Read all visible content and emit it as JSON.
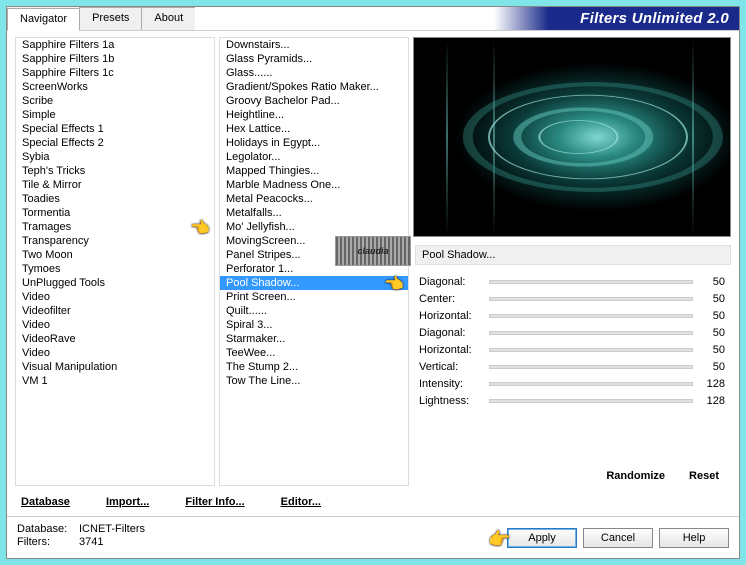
{
  "app_title": "Filters Unlimited 2.0",
  "tabs": [
    "Navigator",
    "Presets",
    "About"
  ],
  "active_tab": 0,
  "categories": [
    "Sapphire Filters 1a",
    "Sapphire Filters 1b",
    "Sapphire Filters 1c",
    "ScreenWorks",
    "Scribe",
    "Simple",
    "Special Effects 1",
    "Special Effects 2",
    "Sybia",
    "Teph's Tricks",
    "Tile & Mirror",
    "Toadies",
    "Tormentia",
    "Tramages",
    "Transparency",
    "Two Moon",
    "Tymoes",
    "UnPlugged Tools",
    "Video",
    "Videofilter",
    "Video",
    "VideoRave",
    "Video",
    "Visual Manipulation",
    "VM 1"
  ],
  "category_selected_index": 13,
  "filters": [
    "Downstairs...",
    "Glass Pyramids...",
    "Glass......",
    "Gradient/Spokes Ratio Maker...",
    "Groovy Bachelor Pad...",
    "Heightline...",
    "Hex Lattice...",
    "Holidays in Egypt...",
    "Legolator...",
    "Mapped Thingies...",
    "Marble Madness One...",
    "Metal Peacocks...",
    "Metalfalls...",
    "Mo' Jellyfish...",
    "MovingScreen...",
    "Panel Stripes...",
    "Perforator 1...",
    "Pool Shadow...",
    "Print Screen...",
    "Quilt......",
    "Spiral 3...",
    "Starmaker...",
    "TeeWee...",
    "The Stump 2...",
    "Tow The Line..."
  ],
  "filter_selected_index": 17,
  "current_filter_label": "Pool Shadow...",
  "watermark_text": "claudia",
  "params": [
    {
      "label": "Diagonal:",
      "value": 50
    },
    {
      "label": "Center:",
      "value": 50
    },
    {
      "label": "Horizontal:",
      "value": 50
    },
    {
      "label": "Diagonal:",
      "value": 50
    },
    {
      "label": "Horizontal:",
      "value": 50
    },
    {
      "label": "Vertical:",
      "value": 50
    },
    {
      "label": "Intensity:",
      "value": 128
    },
    {
      "label": "Lightness:",
      "value": 128
    }
  ],
  "bottom_links": [
    "Database",
    "Import...",
    "Filter Info...",
    "Editor..."
  ],
  "randomize_label": "Randomize",
  "reset_label": "Reset",
  "db_label": "Database:",
  "db_value": "ICNET-Filters",
  "filters_count_label": "Filters:",
  "filters_count_value": "3741",
  "apply_label": "Apply",
  "cancel_label": "Cancel",
  "help_label": "Help"
}
